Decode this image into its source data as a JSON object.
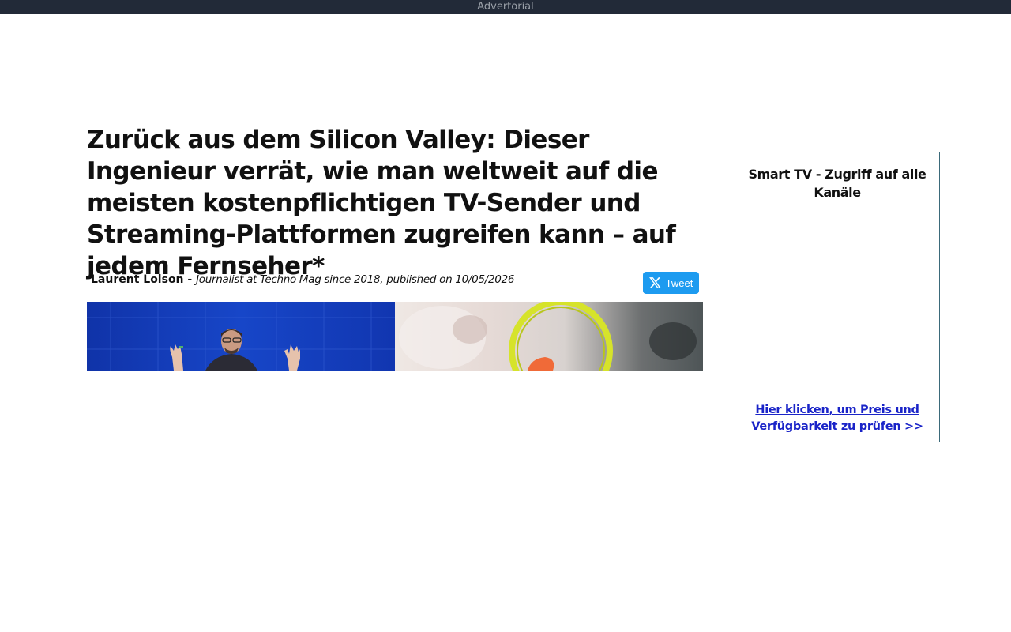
{
  "top_bar": {
    "label": "Advertorial"
  },
  "article": {
    "headline": "Zurück aus dem Silicon Valley: Dieser Ingenieur verrät, wie man weltweit auf die meisten kostenpflichtigen TV-Sender und Streaming-Plattformen zugreifen kann – auf jedem Fernseher*",
    "author": "Laurent Loison",
    "separator": " - ",
    "author_info": "Journalist at Techno Mag since 2018, published on 10/05/2026"
  },
  "share": {
    "tweet_label": "Tweet",
    "icon": "x-logo-icon"
  },
  "sidebar": {
    "title": "Smart TV - Zugriff auf alle Kanäle",
    "link": "Hier klicken, um Preis und Verfügbarkeit zu prüfen >>"
  },
  "colors": {
    "top_bar_bg": "#222a38",
    "tweet_bg": "#1d9bf0",
    "link": "#1a24c8",
    "sidebar_border": "#3b6a7a"
  }
}
